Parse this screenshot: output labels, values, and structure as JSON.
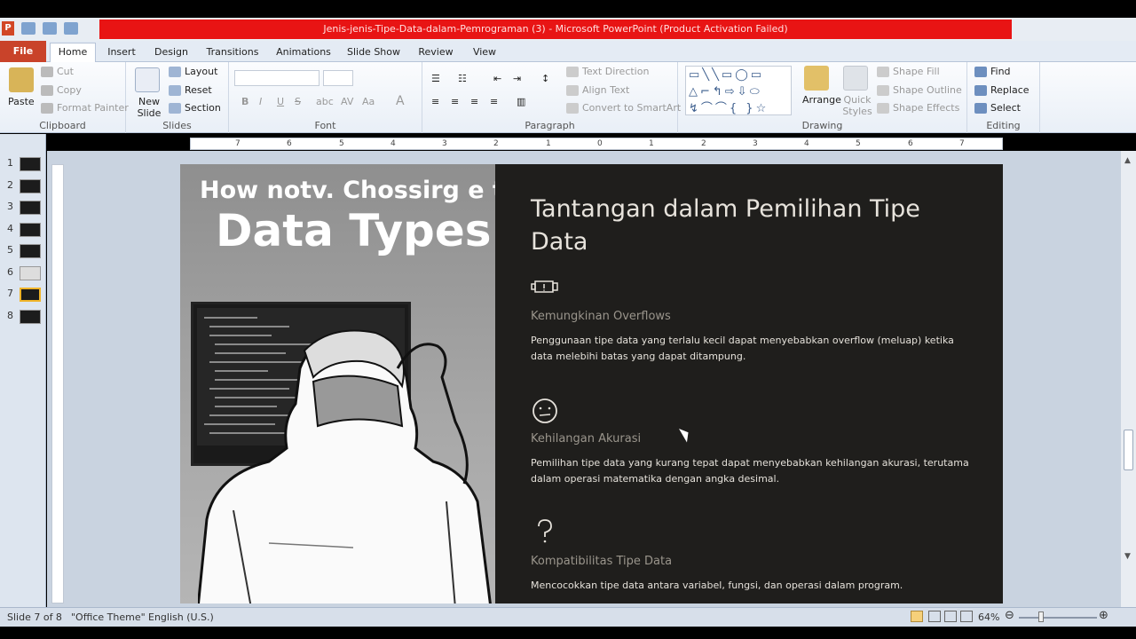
{
  "window": {
    "title": "Jenis-jenis-Tipe-Data-dalam-Pemrograman (3)  -  Microsoft PowerPoint (Product Activation Failed)",
    "app_icon": "P"
  },
  "tabs": {
    "file": "File",
    "items": [
      "Home",
      "Insert",
      "Design",
      "Transitions",
      "Animations",
      "Slide Show",
      "Review",
      "View"
    ],
    "active": "Home"
  },
  "ribbon": {
    "clipboard": {
      "label": "Clipboard",
      "paste": "Paste",
      "cut": "Cut",
      "copy": "Copy",
      "format_painter": "Format Painter"
    },
    "slides": {
      "label": "Slides",
      "new_slide": "New Slide",
      "layout": "Layout",
      "reset": "Reset",
      "section": "Section"
    },
    "font": {
      "label": "Font",
      "bold": "B",
      "italic": "I",
      "underline": "U",
      "strike": "S",
      "shadow": "abc",
      "spacing": "AV",
      "case": "Aa",
      "color": "A"
    },
    "paragraph": {
      "label": "Paragraph",
      "text_direction": "Text Direction",
      "align_text": "Align Text",
      "convert_smartart": "Convert to SmartArt"
    },
    "drawing": {
      "label": "Drawing",
      "arrange": "Arrange",
      "quick_styles": "Quick Styles",
      "shape_fill": "Shape Fill",
      "shape_outline": "Shape Outline",
      "shape_effects": "Shape Effects"
    },
    "editing": {
      "label": "Editing",
      "find": "Find",
      "replace": "Replace",
      "select": "Select"
    }
  },
  "thumbnails": [
    "1",
    "2",
    "3",
    "4",
    "5",
    "6",
    "7",
    "8"
  ],
  "selected_slide": "7",
  "ruler": [
    "7",
    "6",
    "5",
    "4",
    "3",
    "2",
    "1",
    "0",
    "1",
    "2",
    "3",
    "4",
    "5",
    "6",
    "7"
  ],
  "slide": {
    "image_heading_small": "How notv. Chossirg e the",
    "image_heading_big": "Data Types",
    "title": "Tantangan dalam Pemilihan Tipe Data",
    "sections": [
      {
        "icon": "engine-warning-icon",
        "heading": "Kemungkinan Overflows",
        "text": "Penggunaan tipe data yang terlalu kecil dapat menyebabkan overflow (meluap) ketika data melebihi  batas yang dapat ditampung."
      },
      {
        "icon": "neutral-face-icon",
        "heading": "Kehilangan Akurasi",
        "text": "Pemilihan  tipe data yang kurang tepat dapat menyebabkan  kehilangan akurasi, terutama dalam operasi matematika dengan angka desimal."
      },
      {
        "icon": "question-mark-icon",
        "heading": "Kompatibilitas Tipe Data",
        "text": "Mencocokkan tipe data antara variabel, fungsi, dan operasi dalam program."
      }
    ]
  },
  "status": {
    "slide_of": "Slide 7 of 8",
    "theme": "\"Office Theme\"",
    "language": "English (U.S.)",
    "zoom": "64%"
  },
  "colors": {
    "accent_file": "#c9432a",
    "title_red": "#e81414",
    "slide_dark": "#1f1e1c"
  }
}
